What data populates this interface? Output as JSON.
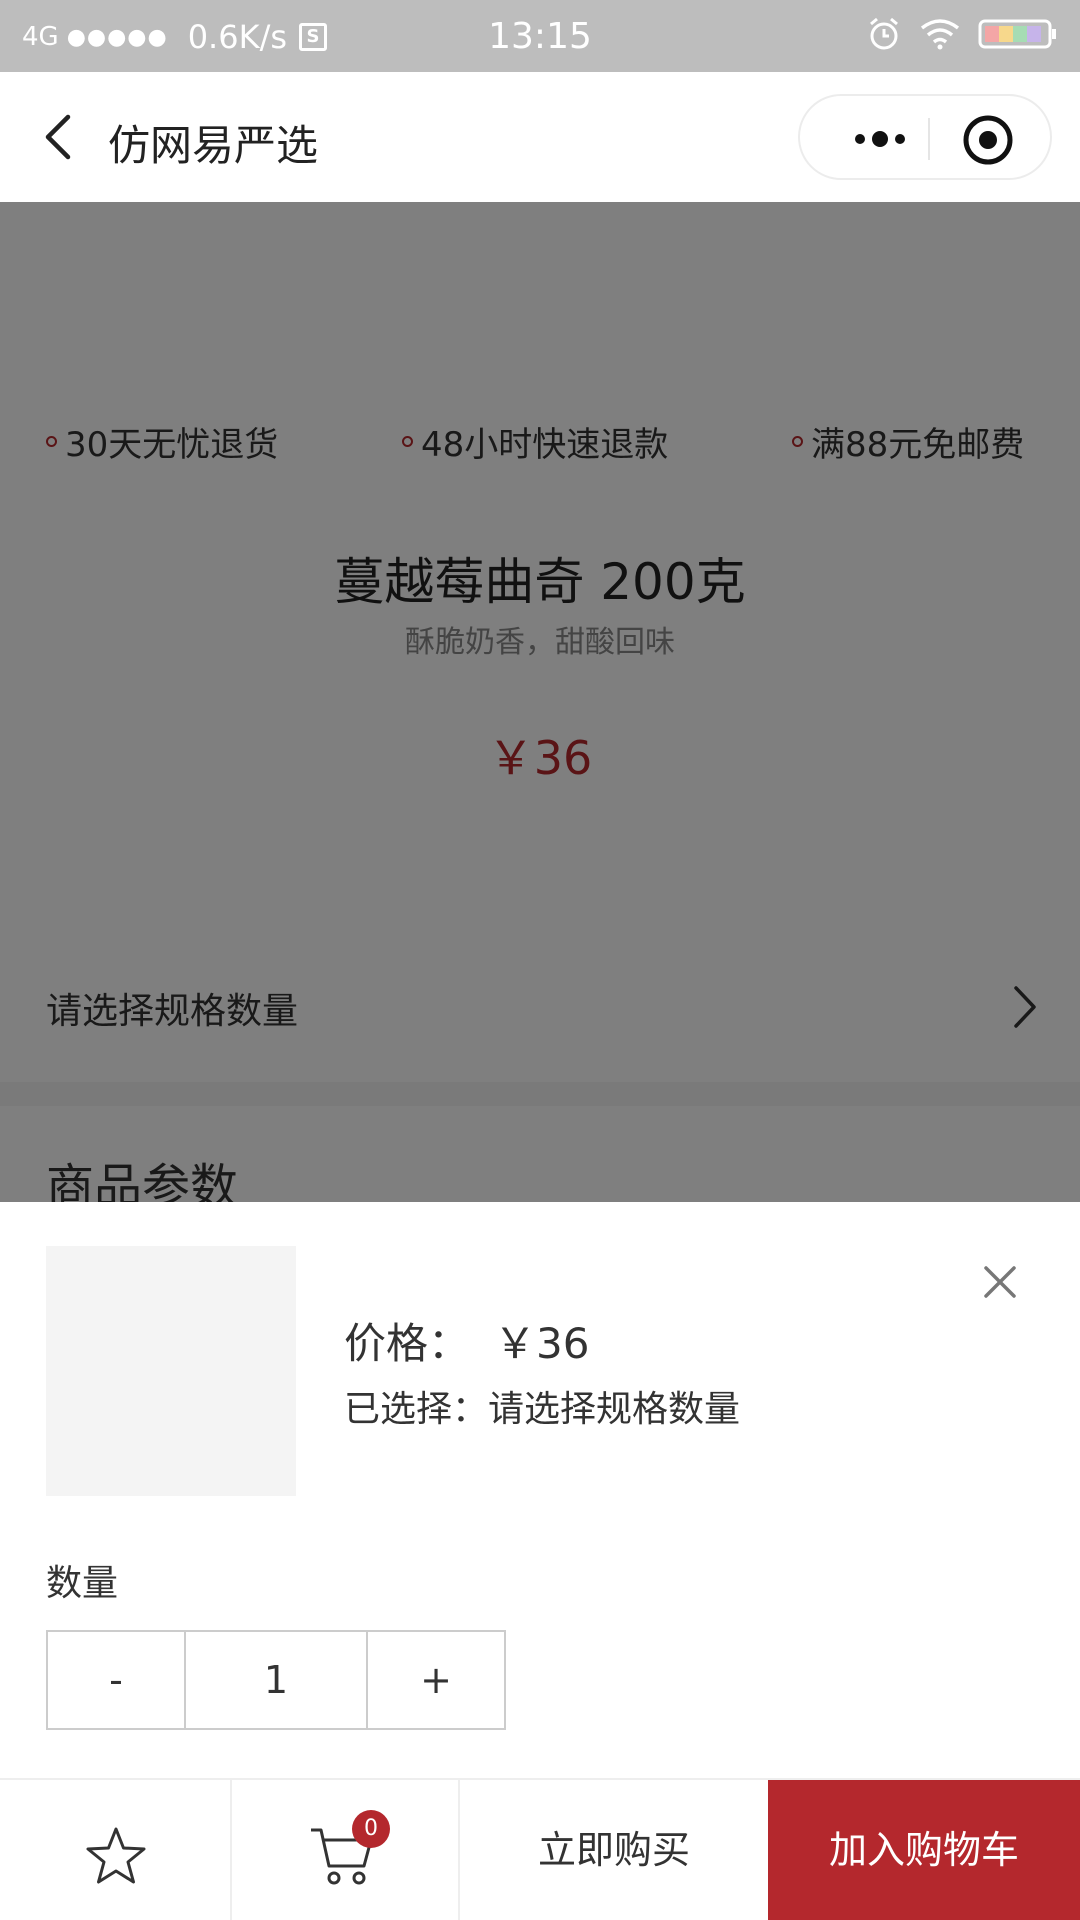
{
  "status_bar": {
    "carrier": "4G",
    "signal": "●●●●●",
    "speed": "0.6K/s",
    "s_badge": "S",
    "time": "13:15"
  },
  "nav": {
    "title": "仿网易严选"
  },
  "goods": {
    "promises": [
      "30天无忧退货",
      "48小时快速退款",
      "满88元免邮费"
    ],
    "name": "蔓越莓曲奇 200克",
    "brief": "酥脆奶香，甜酸回味",
    "price": "￥36",
    "spec_label": "请选择规格数量",
    "params_title": "商品参数"
  },
  "sheet": {
    "price_label": "价格：",
    "price_value": "￥36",
    "selected_text": "已选择：请选择规格数量",
    "qty_label": "数量",
    "minus": "-",
    "qty_value": "1",
    "plus": "+"
  },
  "bottom_bar": {
    "cart_count": "0",
    "buy_now": "立即购买",
    "add_to_cart": "加入购物车"
  },
  "colors": {
    "accent": "#b4282d",
    "status_bar": "#bdbdbd",
    "overlay": "rgba(0,0,0,0.5)"
  },
  "icons": [
    "back-arrow-icon",
    "more-dots-icon",
    "mini-program-close-icon",
    "chevron-right-icon",
    "close-icon",
    "star-icon",
    "cart-icon",
    "alarm-icon",
    "wifi-icon",
    "battery-icon"
  ]
}
